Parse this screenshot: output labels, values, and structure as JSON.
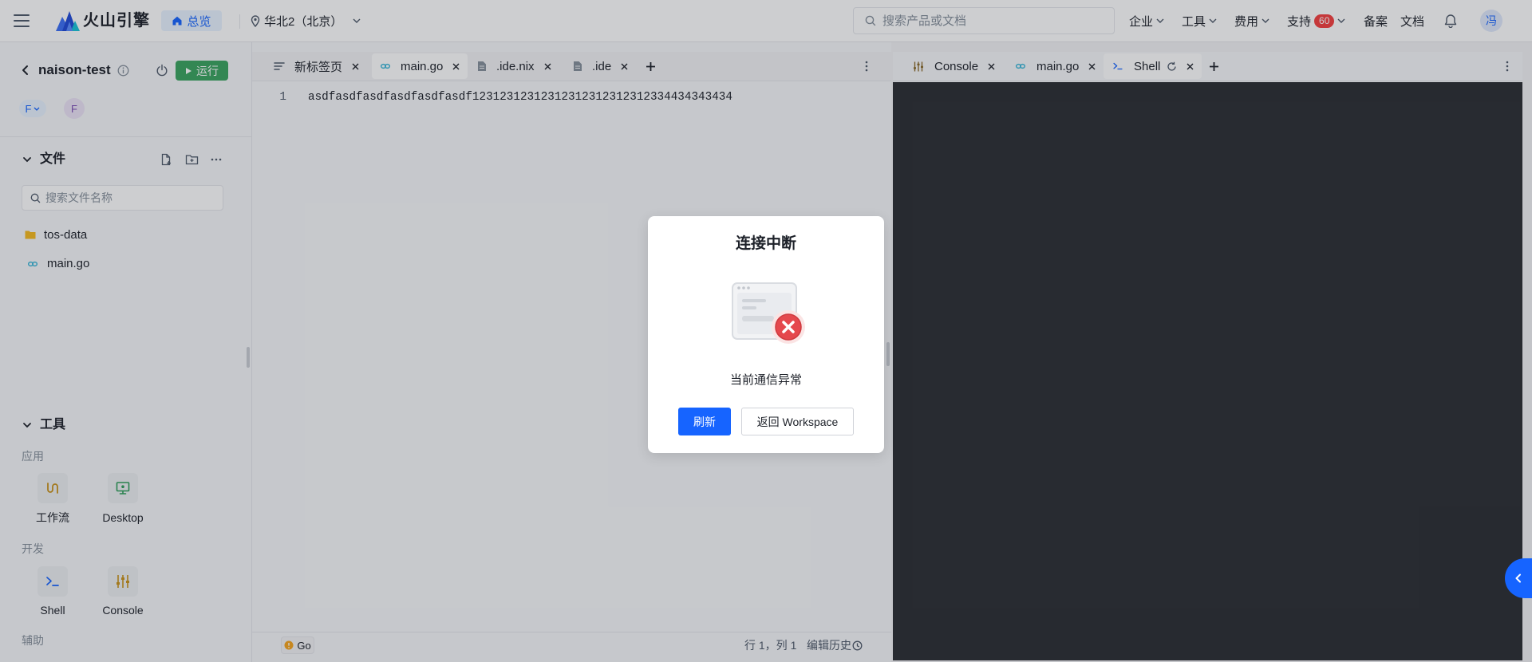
{
  "topbar": {
    "brand": "火山引擎",
    "overview": "总览",
    "region": "华北2（北京）",
    "search_placeholder": "搜索产品或文档",
    "menu": {
      "enterprise": "企业",
      "tools": "工具",
      "billing": "费用",
      "support": "支持",
      "support_badge": "60",
      "filing": "备案",
      "docs": "文档"
    },
    "avatar": "冯"
  },
  "project": {
    "name": "naison-test",
    "run": "运行",
    "branch": "F",
    "member": "F"
  },
  "files": {
    "title": "文件",
    "search_placeholder": "搜索文件名称",
    "items": [
      {
        "name": "tos-data",
        "icon": "folder-icon"
      },
      {
        "name": "main.go",
        "icon": "go-file-icon"
      }
    ]
  },
  "tools": {
    "title": "工具",
    "apps": {
      "label": "应用",
      "items": [
        {
          "name": "工作流",
          "icon": "workflow-icon"
        },
        {
          "name": "Desktop",
          "icon": "desktop-icon"
        }
      ]
    },
    "dev": {
      "label": "开发",
      "items": [
        {
          "name": "Shell",
          "icon": "terminal-icon"
        },
        {
          "name": "Console",
          "icon": "sliders-icon"
        }
      ]
    },
    "assist": {
      "label": "辅助"
    }
  },
  "editor": {
    "tabs": [
      {
        "label": "新标签页",
        "icon": "list-icon"
      },
      {
        "label": "main.go",
        "icon": "go-file-icon",
        "active": true
      },
      {
        "label": ".ide.nix",
        "icon": "file-icon"
      },
      {
        "label": ".ide",
        "icon": "file-icon"
      }
    ],
    "lines": [
      {
        "number": "1",
        "text": "asdfasdfasdfasdfasdfasdf12312312312312312312312312334434343434"
      }
    ],
    "status": {
      "language": "Go",
      "cursor": "行 1，列 1",
      "history": "编辑历史"
    }
  },
  "panel": {
    "tabs": [
      {
        "label": "Console",
        "icon": "sliders-icon"
      },
      {
        "label": "main.go",
        "icon": "go-file-icon"
      },
      {
        "label": "Shell",
        "icon": "terminal-icon",
        "active": true
      }
    ]
  },
  "dialog": {
    "title": "连接中断",
    "message": "当前通信异常",
    "refresh": "刷新",
    "back": "返回 Workspace"
  },
  "colors": {
    "primary": "#1664ff",
    "run": "#3aa55f",
    "badge": "#f53f3f",
    "error": "#e5484d",
    "terminal": "#2b2e33",
    "folder": "#f7ba1e"
  }
}
